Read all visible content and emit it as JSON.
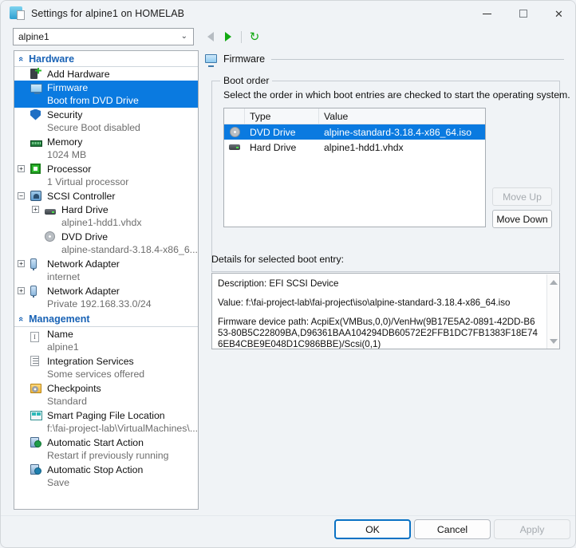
{
  "window": {
    "title": "Settings for alpine1 on HOMELAB",
    "title_icon": "settings-vm-icon",
    "minimize_label": "—",
    "maximize_label": "□",
    "close_label": "✕"
  },
  "toolbar": {
    "vm_selector_value": "alpine1",
    "chevron": "⌄",
    "back_icon": "back-arrow-icon",
    "forward_icon": "forward-arrow-icon",
    "refresh_icon": "refresh-icon",
    "refresh_glyph": "↻"
  },
  "sidebar": {
    "groups": [
      {
        "label": "Hardware",
        "chevron": "«",
        "items": [
          {
            "label": "Add Hardware",
            "sub": "",
            "icon": "add-hardware-icon",
            "selected": false,
            "expander": "",
            "indent": 0
          },
          {
            "label": "Firmware",
            "sub": "Boot from DVD Drive",
            "icon": "firmware-icon",
            "selected": true,
            "expander": "",
            "indent": 0
          },
          {
            "label": "Security",
            "sub": "Secure Boot disabled",
            "icon": "security-shield-icon",
            "selected": false,
            "expander": "",
            "indent": 0
          },
          {
            "label": "Memory",
            "sub": "1024 MB",
            "icon": "memory-icon",
            "selected": false,
            "expander": "",
            "indent": 0
          },
          {
            "label": "Processor",
            "sub": "1 Virtual processor",
            "icon": "processor-icon",
            "selected": false,
            "expander": "+",
            "indent": 0
          },
          {
            "label": "SCSI Controller",
            "sub": "",
            "icon": "scsi-controller-icon",
            "selected": false,
            "expander": "−",
            "indent": 0
          },
          {
            "label": "Hard Drive",
            "sub": "alpine1-hdd1.vhdx",
            "icon": "hard-drive-icon",
            "selected": false,
            "expander": "+",
            "indent": 1
          },
          {
            "label": "DVD Drive",
            "sub": "alpine-standard-3.18.4-x86_6...",
            "icon": "dvd-drive-icon",
            "selected": false,
            "expander": "",
            "indent": 1
          },
          {
            "label": "Network Adapter",
            "sub": "internet",
            "icon": "network-adapter-icon",
            "selected": false,
            "expander": "+",
            "indent": 0
          },
          {
            "label": "Network Adapter",
            "sub": "Private 192.168.33.0/24",
            "icon": "network-adapter-icon",
            "selected": false,
            "expander": "+",
            "indent": 0
          }
        ]
      },
      {
        "label": "Management",
        "chevron": "«",
        "items": [
          {
            "label": "Name",
            "sub": "alpine1",
            "icon": "name-icon",
            "selected": false,
            "expander": "",
            "indent": 0
          },
          {
            "label": "Integration Services",
            "sub": "Some services offered",
            "icon": "integration-services-icon",
            "selected": false,
            "expander": "",
            "indent": 0
          },
          {
            "label": "Checkpoints",
            "sub": "Standard",
            "icon": "checkpoints-icon",
            "selected": false,
            "expander": "",
            "indent": 0
          },
          {
            "label": "Smart Paging File Location",
            "sub": "f:\\fai-project-lab\\VirtualMachines\\...",
            "icon": "smart-paging-icon",
            "selected": false,
            "expander": "",
            "indent": 0
          },
          {
            "label": "Automatic Start Action",
            "sub": "Restart if previously running",
            "icon": "automatic-start-icon",
            "selected": false,
            "expander": "",
            "indent": 0
          },
          {
            "label": "Automatic Stop Action",
            "sub": "Save",
            "icon": "automatic-stop-icon",
            "selected": false,
            "expander": "",
            "indent": 0
          }
        ]
      }
    ]
  },
  "content": {
    "header": "Firmware",
    "header_icon": "firmware-icon",
    "boot_order": {
      "group_title": "Boot order",
      "description": "Select the order in which boot entries are checked to start the operating system.",
      "columns": [
        "",
        "Type",
        "Value"
      ],
      "rows": [
        {
          "icon": "dvd-drive-icon",
          "type": "DVD Drive",
          "value": "alpine-standard-3.18.4-x86_64.iso",
          "selected": true
        },
        {
          "icon": "hard-drive-icon",
          "type": "Hard Drive",
          "value": "alpine1-hdd1.vhdx",
          "selected": false
        }
      ],
      "move_up_label": "Move Up",
      "move_up_enabled": false,
      "move_down_label": "Move Down",
      "move_down_enabled": true
    },
    "details": {
      "label": "Details for selected boot entry:",
      "description_line": "Description: EFI SCSI Device",
      "value_line": "Value: f:\\fai-project-lab\\fai-project\\iso\\alpine-standard-3.18.4-x86_64.iso",
      "firmware_path_line": "Firmware device path: AcpiEx(VMBus,0,0)/VenHw(9B17E5A2-0891-42DD-B653-80B5C22809BA,D96361BAA104294DB60572E2FFB1DC7FB1383F18E746EB4CBE9E048D1C986BBE)/Scsi(0,1)",
      "scroll_up_icon": "scroll-up-arrow-icon",
      "scroll_down_icon": "scroll-down-arrow-icon"
    }
  },
  "footer": {
    "ok_label": "OK",
    "cancel_label": "Cancel",
    "apply_label": "Apply",
    "apply_enabled": false
  },
  "colors": {
    "accent_selection": "#0a7ae0",
    "group_header": "#1862b5",
    "window_bg": "#f0f3f6",
    "default_button_border": "#0a72c4",
    "enabled_nav_green": "#12a912"
  }
}
